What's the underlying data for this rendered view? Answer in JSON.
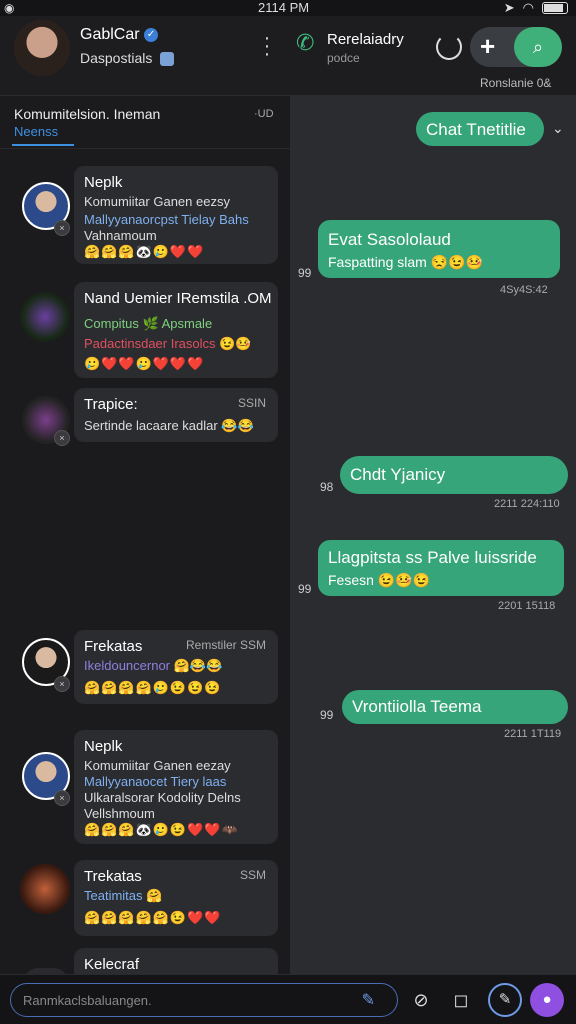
{
  "status": {
    "time": "2114 PM"
  },
  "header": {
    "contact_name": "GablCar",
    "contact_sub": "Daspostials",
    "chat_title": "Rerelaiadry",
    "chat_sub": "podce",
    "resolve_label": "Ronslanie 0&"
  },
  "left_tab": {
    "title": "Komumitelsion. Ineman",
    "subtitle": "Neenss",
    "right": "·UD"
  },
  "conversations": [
    {
      "title": "Neplk",
      "time": "",
      "lines": [
        "Komumiitar Ganen eezsy",
        "Mallyyanaorcpst Tielay Bahs",
        "Vahnamoum"
      ],
      "emojis": "🤗🤗🤗🐼🥲❤️❤️"
    },
    {
      "title": "Nand Uemier IRemstila .OM",
      "time": "",
      "lines": [
        "Compitus 🌿 Apsmale",
        "Padactinsdaer Irasolcs 😉🤒"
      ],
      "emojis": "🥲❤️❤️🥲❤️❤️❤️"
    },
    {
      "title": "Trapice:",
      "time": "SSIN",
      "lines": [
        "Sertinde lacaare kadlar 😂😂"
      ],
      "emojis": ""
    },
    {
      "title": "Frekatas",
      "time": "Remstiler SSM",
      "lines": [
        "Ikeldouncernor 🤗😂😂"
      ],
      "emojis": "🤗🤗🤗🤗🥲😉😉😉"
    },
    {
      "title": "Neplk",
      "time": "",
      "lines": [
        "Komumiitar Ganen eezay",
        "Mallyyanaocet Tiery laas",
        "Ulkaralsorar Kodolity Delns",
        "Vellshmoum"
      ],
      "emojis": "🤗🤗🤗🐼🥲😉❤️❤️🦇"
    },
    {
      "title": "Trekatas",
      "time": "SSM",
      "lines": [
        "Teatimitas 🤗"
      ],
      "emojis": "🤗🤗🤗🤗🤗😉❤️❤️"
    },
    {
      "title": "Kelecraf",
      "time": "",
      "lines": [],
      "emojis": ""
    }
  ],
  "messages": [
    {
      "text": "Chat Tnetitlie",
      "sub": "",
      "time": "",
      "side": ""
    },
    {
      "text": "Evat Sasololaud",
      "sub": "Faspatting slam 😒😉🤒",
      "time": "4Sy4S:42",
      "side": "99"
    },
    {
      "text": "Chdt Yjanicy",
      "sub": "",
      "time": "2211 224:110",
      "side": "98"
    },
    {
      "text": "Llagpitsta ss Palve luissride",
      "sub": "Fesesn 😉🤒😉",
      "time": "2201 15118",
      "side": "99"
    },
    {
      "text": "Vrontiiolla Teema",
      "sub": "",
      "time": "2211 1T119",
      "side": "99"
    }
  ],
  "composer": {
    "placeholder": "Ranmkaclsbaluangen."
  },
  "colors": {
    "accent": "#37a57a",
    "link": "#3d8fe0",
    "mic": "#8f4fe0"
  }
}
